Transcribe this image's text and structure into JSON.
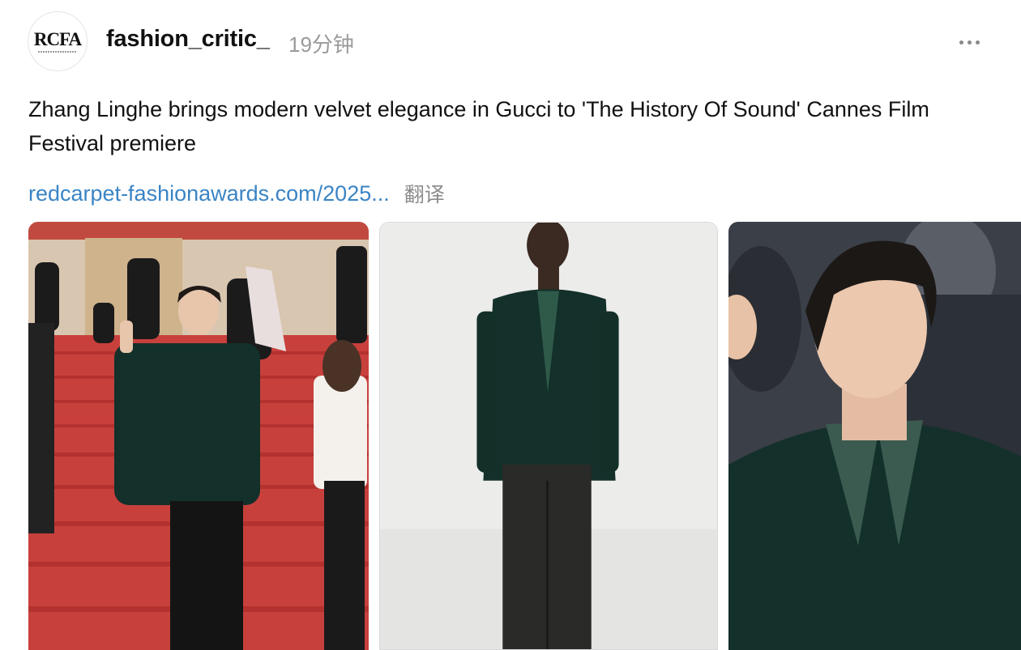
{
  "post": {
    "avatar_text": "RCFA",
    "username": "fashion_critic_",
    "timestamp": "19分钟",
    "more_label": "···",
    "text": "Zhang Linghe brings modern velvet elegance in Gucci to 'The History Of Sound' Cannes Film Festival premiere",
    "link_text": "redcarpet-fashionawards.com/2025...",
    "translate_label": "翻译"
  },
  "colors": {
    "link": "#3a84c4",
    "muted": "#9a9a9a",
    "velvet_green": "#14302a",
    "red_carpet": "#c8403c"
  },
  "gallery": [
    {
      "id": "photo-red-carpet",
      "alt": "Red carpet photo"
    },
    {
      "id": "photo-runway-look",
      "alt": "Runway look photo"
    },
    {
      "id": "photo-closeup",
      "alt": "Close-up photo"
    }
  ]
}
